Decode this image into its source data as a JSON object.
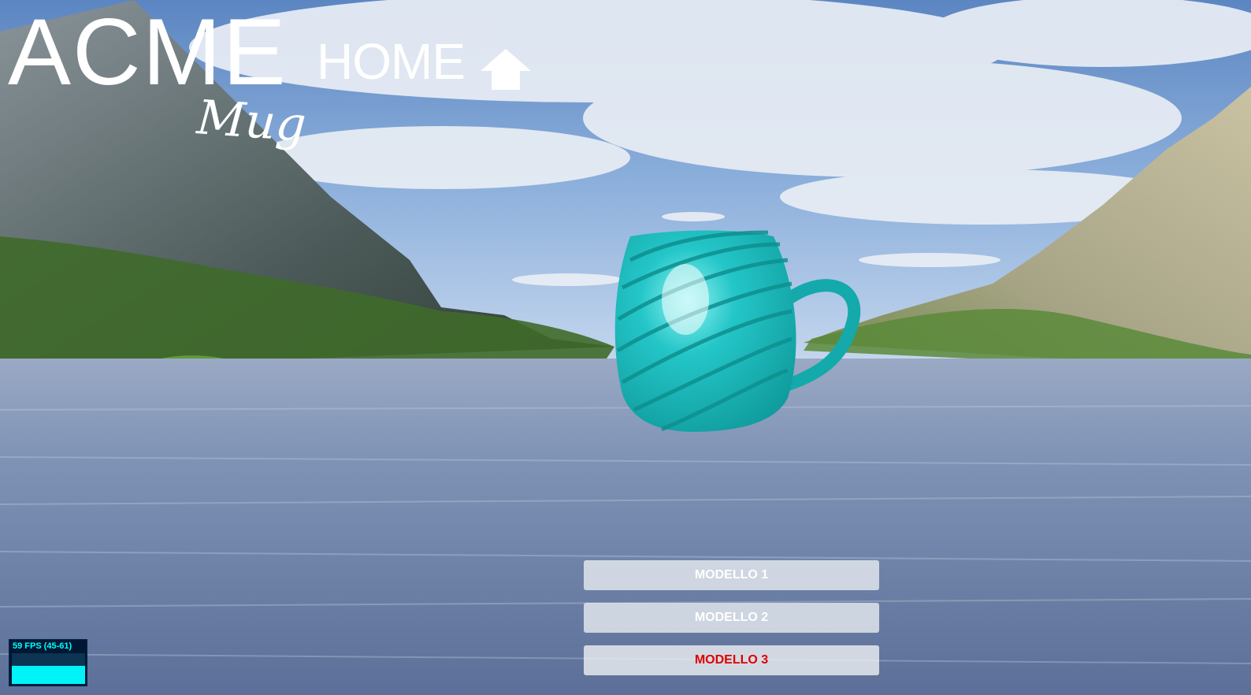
{
  "header": {
    "brand": "ACME",
    "section": "HOME",
    "home_icon": "home-icon",
    "subtitle": "Mug"
  },
  "viewer": {
    "model_object": "mug",
    "mug_color": "#20c2c4",
    "models": [
      {
        "label": "MODELLO 1",
        "active": false
      },
      {
        "label": "MODELLO 2",
        "active": false
      },
      {
        "label": "MODELLO 3",
        "active": true
      }
    ],
    "active_color": "#e00000"
  },
  "stats": {
    "fps_label": "59 FPS (45-61)",
    "fps_current": 59,
    "fps_min": 45,
    "fps_max": 61
  }
}
